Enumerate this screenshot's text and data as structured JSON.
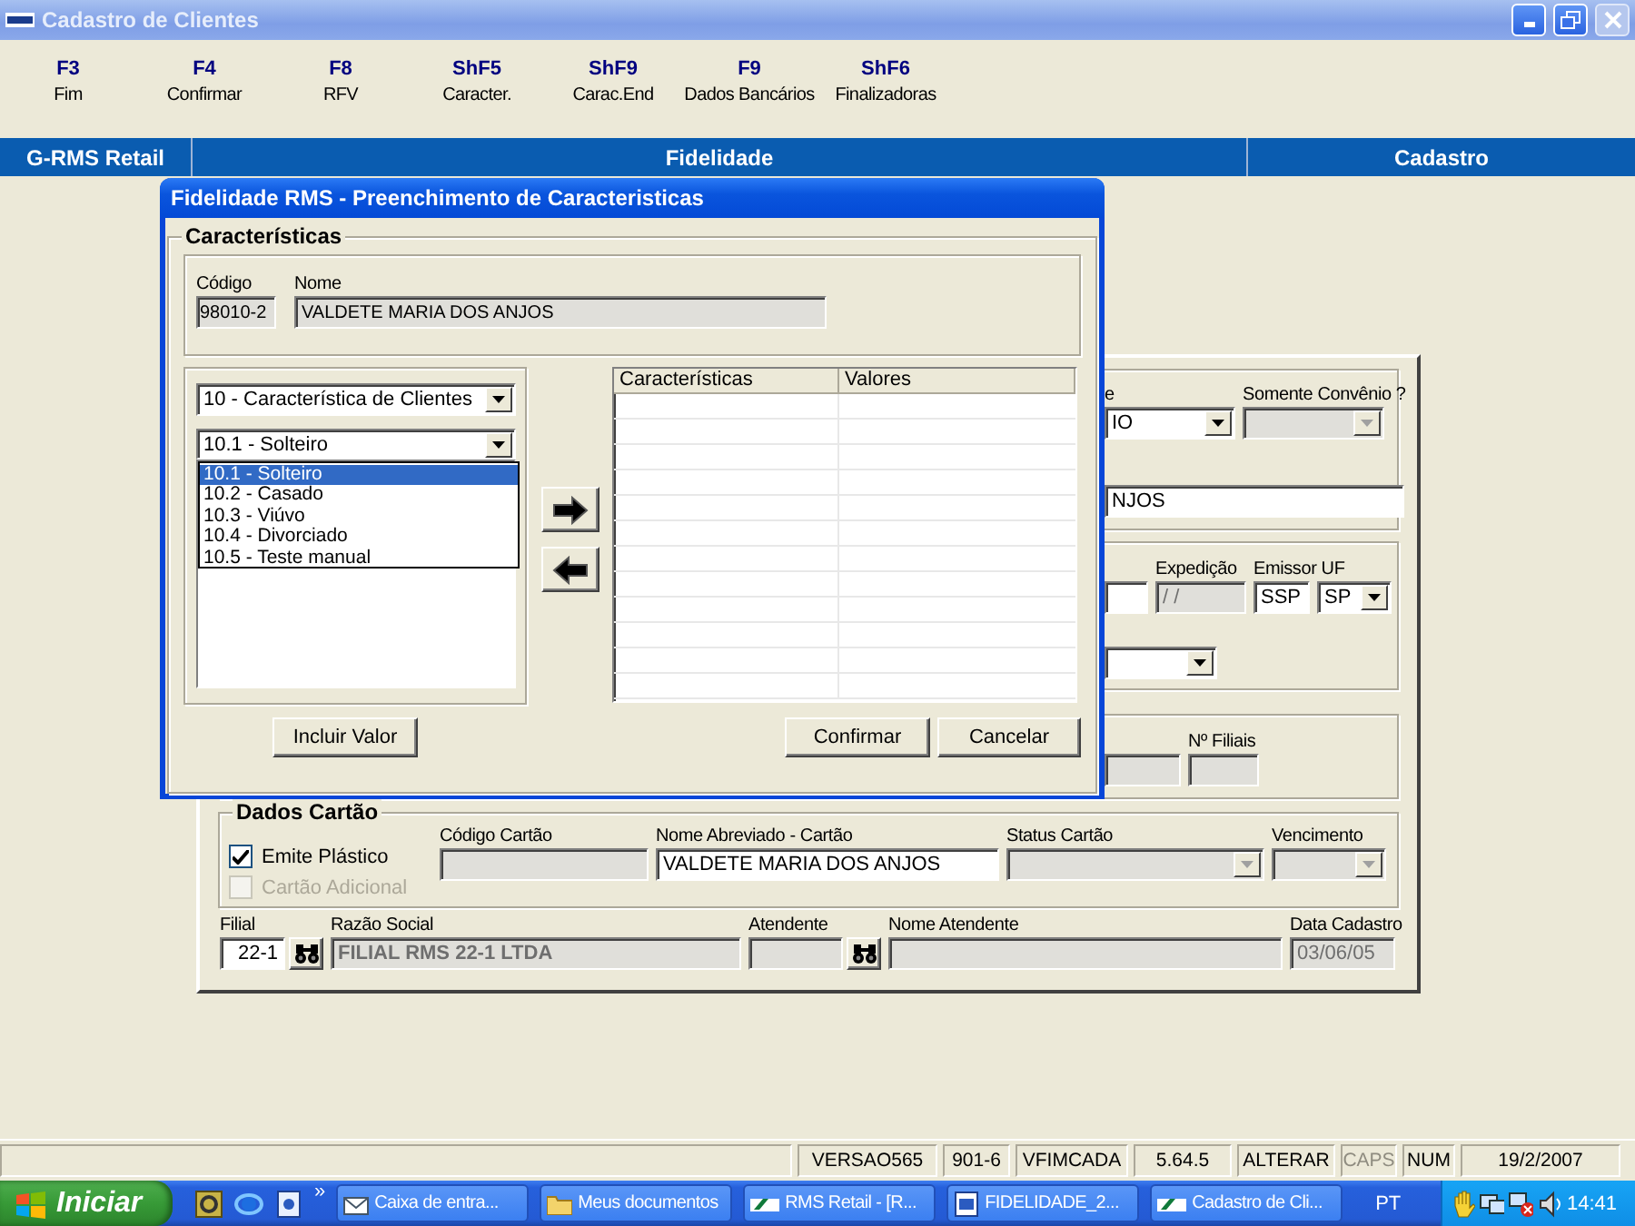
{
  "window": {
    "title": "Cadastro de Clientes"
  },
  "toolbar": [
    {
      "key": "F3",
      "label": "Fim"
    },
    {
      "key": "F4",
      "label": "Confirmar"
    },
    {
      "key": "F8",
      "label": "RFV"
    },
    {
      "key": "ShF5",
      "label": "Caracter."
    },
    {
      "key": "ShF9",
      "label": "Carac.End"
    },
    {
      "key": "F9",
      "label": "Dados Bancários"
    },
    {
      "key": "ShF6",
      "label": "Finalizadoras"
    }
  ],
  "header": [
    "G-RMS Retail",
    "Fidelidade",
    "Cadastro"
  ],
  "form": {
    "groups": [
      {
        "rows": [
          [
            {
              "kind": "select",
              "label": "e",
              "value": "IO",
              "disabled": false
            },
            {
              "kind": "select",
              "label": "Somente Convênio ?",
              "disabled": true
            }
          ],
          [
            {
              "kind": "input",
              "value": "NJOS",
              "disabled": false
            }
          ]
        ]
      },
      {
        "rows": [
          [
            {
              "kind": "input",
              "disabled": false
            },
            {
              "kind": "input",
              "label": "Expedição",
              "value": "/ /",
              "disabled": true
            },
            {
              "kind": "input",
              "label": "Emissor UF",
              "value": "SSP",
              "disabled": false
            },
            {
              "kind": "select",
              "value": "SP",
              "disabled": false
            }
          ],
          [
            {
              "kind": "select",
              "disabled": false
            }
          ]
        ]
      },
      {
        "rows": [
          [
            {
              "kind": "input",
              "disabled": true
            },
            {
              "kind": "input",
              "label": "Nº Filiais",
              "disabled": true
            }
          ]
        ]
      }
    ],
    "card": {
      "title": "Dados Cartão",
      "checkboxes": [
        {
          "label": "Emite Plástico",
          "checked": true,
          "disabled": false
        },
        {
          "label": "Cartão Adicional",
          "checked": false,
          "disabled": true
        }
      ],
      "fields": [
        {
          "kind": "input",
          "label": "Código Cartão",
          "disabled": true
        },
        {
          "kind": "input",
          "label": "Nome Abreviado - Cartão",
          "value": "VALDETE MARIA DOS ANJOS",
          "disabled": false
        },
        {
          "kind": "select",
          "label": "Status Cartão",
          "disabled": true
        },
        {
          "kind": "select",
          "label": "Vencimento",
          "disabled": true
        }
      ]
    },
    "bottom": [
      {
        "kind": "input",
        "label": "Filial",
        "value": "22-1",
        "disabled": false,
        "lookup": true
      },
      {
        "kind": "input",
        "label": "Razão Social",
        "value": "FILIAL RMS 22-1 LTDA",
        "disabled": true,
        "lookup": false
      },
      {
        "kind": "input",
        "label": "Atendente",
        "disabled": true,
        "lookup": true
      },
      {
        "kind": "input",
        "label": "Nome Atendente",
        "disabled": true,
        "lookup": false
      },
      {
        "kind": "input",
        "label": "Data Cadastro",
        "value": "03/06/05",
        "disabled": true,
        "lookup": false
      }
    ]
  },
  "dialog": {
    "title": "Fidelidade RMS - Preenchimento de Caracteristicas",
    "group_title": "Características",
    "codigo": {
      "label": "Código",
      "value": "98010-2"
    },
    "nome": {
      "label": "Nome",
      "value": "VALDETE MARIA DOS ANJOS"
    },
    "category_select": "10 - Característica de Clientes",
    "value_select": "10.1 - Solteiro",
    "options": [
      {
        "label": "10.1 - Solteiro",
        "selected": true
      },
      {
        "label": "10.2 - Casado",
        "selected": false
      },
      {
        "label": "10.3 - Viúvo",
        "selected": false
      },
      {
        "label": "10.4 - Divorciado",
        "selected": false
      },
      {
        "label": "10.5 - Teste manual",
        "selected": false
      }
    ],
    "columns": [
      "Características",
      "Valores"
    ],
    "buttons": [
      "Incluir Valor",
      "Confirmar",
      "Cancelar"
    ]
  },
  "status_bar": [
    {
      "text": "VERSAO565",
      "disabled": false
    },
    {
      "text": "901-6",
      "disabled": false
    },
    {
      "text": "VFIMCADA",
      "disabled": false
    },
    {
      "text": "5.64.5",
      "disabled": false
    },
    {
      "text": "ALTERAR",
      "disabled": false
    },
    {
      "text": "CAPS",
      "disabled": true
    },
    {
      "text": "NUM",
      "disabled": false
    },
    {
      "text": "19/2/2007",
      "disabled": false
    }
  ],
  "taskbar": {
    "start": "Iniciar",
    "more": "»",
    "tasks": [
      "Caixa de entra...",
      "Meus documentos",
      "RMS Retail - [R...",
      "FIDELIDADE_2...",
      "Cadastro de Cli..."
    ],
    "language": "PT",
    "clock": "14:41"
  }
}
